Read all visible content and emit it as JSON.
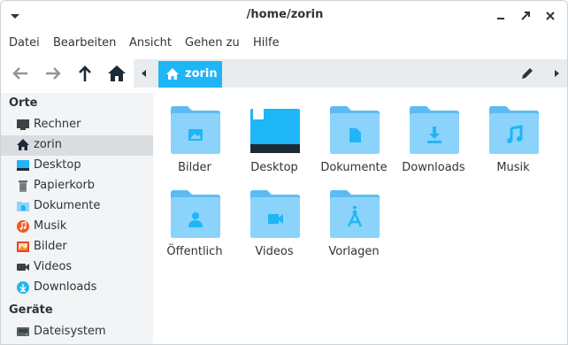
{
  "window": {
    "title": "/home/zorin"
  },
  "menubar": {
    "items": [
      "Datei",
      "Bearbeiten",
      "Ansicht",
      "Gehen zu",
      "Hilfe"
    ]
  },
  "toolbar": {
    "back_icon": "arrow-left-icon",
    "forward_icon": "arrow-right-icon",
    "up_icon": "arrow-up-icon",
    "home_icon": "home-icon",
    "path_current": "zorin",
    "edit_icon": "pencil-icon"
  },
  "sidebar": {
    "places_heading": "Orte",
    "places": [
      {
        "label": "Rechner",
        "icon": "computer-icon"
      },
      {
        "label": "zorin",
        "icon": "home-icon",
        "selected": true
      },
      {
        "label": "Desktop",
        "icon": "desktop-icon"
      },
      {
        "label": "Papierkorb",
        "icon": "trash-icon"
      },
      {
        "label": "Dokumente",
        "icon": "documents-icon"
      },
      {
        "label": "Musik",
        "icon": "music-icon"
      },
      {
        "label": "Bilder",
        "icon": "pictures-icon"
      },
      {
        "label": "Videos",
        "icon": "videos-icon"
      },
      {
        "label": "Downloads",
        "icon": "downloads-icon"
      }
    ],
    "devices_heading": "Geräte",
    "devices": [
      {
        "label": "Dateisystem",
        "icon": "drive-icon"
      }
    ]
  },
  "main": {
    "items": [
      {
        "label": "Bilder",
        "icon": "folder-pictures-icon"
      },
      {
        "label": "Desktop",
        "icon": "folder-desktop-icon"
      },
      {
        "label": "Dokumente",
        "icon": "folder-documents-icon"
      },
      {
        "label": "Downloads",
        "icon": "folder-downloads-icon"
      },
      {
        "label": "Musik",
        "icon": "folder-music-icon"
      },
      {
        "label": "Öffentlich",
        "icon": "folder-public-icon"
      },
      {
        "label": "Videos",
        "icon": "folder-videos-icon"
      },
      {
        "label": "Vorlagen",
        "icon": "folder-templates-icon"
      }
    ]
  },
  "colors": {
    "accent": "#1eb6f6",
    "folder_light": "#8cd3fb",
    "folder_dark": "#5cbcf2",
    "sidebar_bg": "#f3f4f5",
    "selected_bg": "#dadde0"
  }
}
